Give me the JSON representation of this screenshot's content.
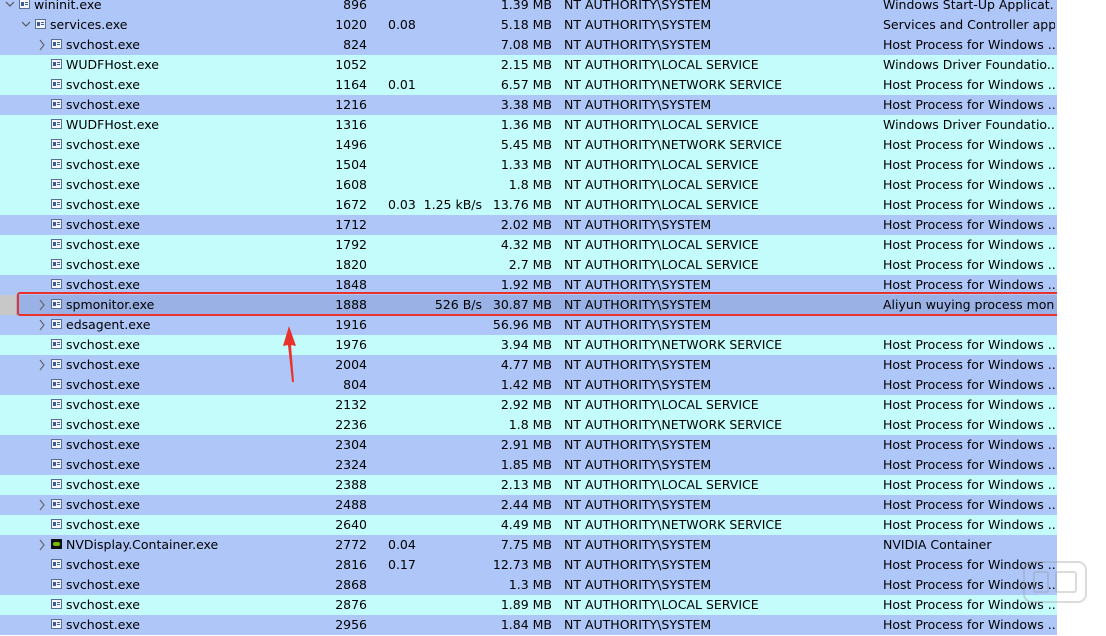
{
  "colors": {
    "row_cyan": "#c4fcfc",
    "row_blue": "#aec6f8",
    "row_selected": "#99b1e4",
    "highlight": "#e8322b"
  },
  "process_rows": [
    {
      "name": "wininit.exe",
      "pid": "896",
      "cpu": "",
      "io": "",
      "mem": "1.39 MB",
      "user": "NT AUTHORITY\\SYSTEM",
      "desc": "Windows Start-Up Applicat...",
      "indent": 0,
      "expander": "open",
      "icon": "process",
      "bg": "blue"
    },
    {
      "name": "services.exe",
      "pid": "1020",
      "cpu": "0.08",
      "io": "",
      "mem": "5.18 MB",
      "user": "NT AUTHORITY\\SYSTEM",
      "desc": "Services and Controller app",
      "indent": 1,
      "expander": "open",
      "icon": "process",
      "bg": "blue"
    },
    {
      "name": "svchost.exe",
      "pid": "824",
      "cpu": "",
      "io": "",
      "mem": "7.08 MB",
      "user": "NT AUTHORITY\\SYSTEM",
      "desc": "Host Process for Windows ...",
      "indent": 2,
      "expander": "closed",
      "icon": "process",
      "bg": "blue"
    },
    {
      "name": "WUDFHost.exe",
      "pid": "1052",
      "cpu": "",
      "io": "",
      "mem": "2.15 MB",
      "user": "NT AUTHORITY\\LOCAL SERVICE",
      "desc": "Windows Driver Foundatio...",
      "indent": 2,
      "expander": "none",
      "icon": "process",
      "bg": "cyan"
    },
    {
      "name": "svchost.exe",
      "pid": "1164",
      "cpu": "0.01",
      "io": "",
      "mem": "6.57 MB",
      "user": "NT AUTHORITY\\NETWORK SERVICE",
      "desc": "Host Process for Windows ...",
      "indent": 2,
      "expander": "none",
      "icon": "process",
      "bg": "cyan"
    },
    {
      "name": "svchost.exe",
      "pid": "1216",
      "cpu": "",
      "io": "",
      "mem": "3.38 MB",
      "user": "NT AUTHORITY\\SYSTEM",
      "desc": "Host Process for Windows ...",
      "indent": 2,
      "expander": "none",
      "icon": "process",
      "bg": "blue"
    },
    {
      "name": "WUDFHost.exe",
      "pid": "1316",
      "cpu": "",
      "io": "",
      "mem": "1.36 MB",
      "user": "NT AUTHORITY\\LOCAL SERVICE",
      "desc": "Windows Driver Foundatio...",
      "indent": 2,
      "expander": "none",
      "icon": "process",
      "bg": "cyan"
    },
    {
      "name": "svchost.exe",
      "pid": "1496",
      "cpu": "",
      "io": "",
      "mem": "5.45 MB",
      "user": "NT AUTHORITY\\NETWORK SERVICE",
      "desc": "Host Process for Windows ...",
      "indent": 2,
      "expander": "none",
      "icon": "process",
      "bg": "cyan"
    },
    {
      "name": "svchost.exe",
      "pid": "1504",
      "cpu": "",
      "io": "",
      "mem": "1.33 MB",
      "user": "NT AUTHORITY\\LOCAL SERVICE",
      "desc": "Host Process for Windows ...",
      "indent": 2,
      "expander": "none",
      "icon": "process",
      "bg": "cyan"
    },
    {
      "name": "svchost.exe",
      "pid": "1608",
      "cpu": "",
      "io": "",
      "mem": "1.8 MB",
      "user": "NT AUTHORITY\\LOCAL SERVICE",
      "desc": "Host Process for Windows ...",
      "indent": 2,
      "expander": "none",
      "icon": "process",
      "bg": "cyan"
    },
    {
      "name": "svchost.exe",
      "pid": "1672",
      "cpu": "0.03",
      "io": "1.25 kB/s",
      "mem": "13.76 MB",
      "user": "NT AUTHORITY\\LOCAL SERVICE",
      "desc": "Host Process for Windows ...",
      "indent": 2,
      "expander": "none",
      "icon": "process",
      "bg": "cyan"
    },
    {
      "name": "svchost.exe",
      "pid": "1712",
      "cpu": "",
      "io": "",
      "mem": "2.02 MB",
      "user": "NT AUTHORITY\\SYSTEM",
      "desc": "Host Process for Windows ...",
      "indent": 2,
      "expander": "none",
      "icon": "process",
      "bg": "blue"
    },
    {
      "name": "svchost.exe",
      "pid": "1792",
      "cpu": "",
      "io": "",
      "mem": "4.32 MB",
      "user": "NT AUTHORITY\\LOCAL SERVICE",
      "desc": "Host Process for Windows ...",
      "indent": 2,
      "expander": "none",
      "icon": "process",
      "bg": "cyan"
    },
    {
      "name": "svchost.exe",
      "pid": "1820",
      "cpu": "",
      "io": "",
      "mem": "2.7 MB",
      "user": "NT AUTHORITY\\LOCAL SERVICE",
      "desc": "Host Process for Windows ...",
      "indent": 2,
      "expander": "none",
      "icon": "process",
      "bg": "cyan"
    },
    {
      "name": "svchost.exe",
      "pid": "1848",
      "cpu": "",
      "io": "",
      "mem": "1.92 MB",
      "user": "NT AUTHORITY\\SYSTEM",
      "desc": "Host Process for Windows ...",
      "indent": 2,
      "expander": "none",
      "icon": "process",
      "bg": "blue"
    },
    {
      "name": "spmonitor.exe",
      "pid": "1888",
      "cpu": "",
      "io": "526 B/s",
      "mem": "30.87 MB",
      "user": "NT AUTHORITY\\SYSTEM",
      "desc": "Aliyun wuying process mon...",
      "indent": 2,
      "expander": "closed",
      "icon": "process",
      "bg": "sel"
    },
    {
      "name": "edsagent.exe",
      "pid": "1916",
      "cpu": "",
      "io": "",
      "mem": "56.96 MB",
      "user": "NT AUTHORITY\\SYSTEM",
      "desc": "",
      "indent": 2,
      "expander": "closed",
      "icon": "process",
      "bg": "blue"
    },
    {
      "name": "svchost.exe",
      "pid": "1976",
      "cpu": "",
      "io": "",
      "mem": "3.94 MB",
      "user": "NT AUTHORITY\\NETWORK SERVICE",
      "desc": "Host Process for Windows ...",
      "indent": 2,
      "expander": "none",
      "icon": "process",
      "bg": "cyan"
    },
    {
      "name": "svchost.exe",
      "pid": "2004",
      "cpu": "",
      "io": "",
      "mem": "4.77 MB",
      "user": "NT AUTHORITY\\SYSTEM",
      "desc": "Host Process for Windows ...",
      "indent": 2,
      "expander": "closed",
      "icon": "process",
      "bg": "blue"
    },
    {
      "name": "svchost.exe",
      "pid": "804",
      "cpu": "",
      "io": "",
      "mem": "1.42 MB",
      "user": "NT AUTHORITY\\SYSTEM",
      "desc": "Host Process for Windows ...",
      "indent": 2,
      "expander": "none",
      "icon": "process",
      "bg": "blue"
    },
    {
      "name": "svchost.exe",
      "pid": "2132",
      "cpu": "",
      "io": "",
      "mem": "2.92 MB",
      "user": "NT AUTHORITY\\LOCAL SERVICE",
      "desc": "Host Process for Windows ...",
      "indent": 2,
      "expander": "none",
      "icon": "process",
      "bg": "cyan"
    },
    {
      "name": "svchost.exe",
      "pid": "2236",
      "cpu": "",
      "io": "",
      "mem": "1.8 MB",
      "user": "NT AUTHORITY\\NETWORK SERVICE",
      "desc": "Host Process for Windows ...",
      "indent": 2,
      "expander": "none",
      "icon": "process",
      "bg": "cyan"
    },
    {
      "name": "svchost.exe",
      "pid": "2304",
      "cpu": "",
      "io": "",
      "mem": "2.91 MB",
      "user": "NT AUTHORITY\\SYSTEM",
      "desc": "Host Process for Windows ...",
      "indent": 2,
      "expander": "none",
      "icon": "process",
      "bg": "blue"
    },
    {
      "name": "svchost.exe",
      "pid": "2324",
      "cpu": "",
      "io": "",
      "mem": "1.85 MB",
      "user": "NT AUTHORITY\\SYSTEM",
      "desc": "Host Process for Windows ...",
      "indent": 2,
      "expander": "none",
      "icon": "process",
      "bg": "blue"
    },
    {
      "name": "svchost.exe",
      "pid": "2388",
      "cpu": "",
      "io": "",
      "mem": "2.13 MB",
      "user": "NT AUTHORITY\\LOCAL SERVICE",
      "desc": "Host Process for Windows ...",
      "indent": 2,
      "expander": "none",
      "icon": "process",
      "bg": "cyan"
    },
    {
      "name": "svchost.exe",
      "pid": "2488",
      "cpu": "",
      "io": "",
      "mem": "2.44 MB",
      "user": "NT AUTHORITY\\SYSTEM",
      "desc": "Host Process for Windows ...",
      "indent": 2,
      "expander": "closed",
      "icon": "process",
      "bg": "blue"
    },
    {
      "name": "svchost.exe",
      "pid": "2640",
      "cpu": "",
      "io": "",
      "mem": "4.49 MB",
      "user": "NT AUTHORITY\\NETWORK SERVICE",
      "desc": "Host Process for Windows ...",
      "indent": 2,
      "expander": "none",
      "icon": "process",
      "bg": "cyan"
    },
    {
      "name": "NVDisplay.Container.exe",
      "pid": "2772",
      "cpu": "0.04",
      "io": "",
      "mem": "7.75 MB",
      "user": "NT AUTHORITY\\SYSTEM",
      "desc": "NVIDIA Container",
      "indent": 2,
      "expander": "closed",
      "icon": "nvidia",
      "bg": "blue"
    },
    {
      "name": "svchost.exe",
      "pid": "2816",
      "cpu": "0.17",
      "io": "",
      "mem": "12.73 MB",
      "user": "NT AUTHORITY\\SYSTEM",
      "desc": "Host Process for Windows ...",
      "indent": 2,
      "expander": "none",
      "icon": "process",
      "bg": "blue"
    },
    {
      "name": "svchost.exe",
      "pid": "2868",
      "cpu": "",
      "io": "",
      "mem": "1.3 MB",
      "user": "NT AUTHORITY\\SYSTEM",
      "desc": "Host Process for Windows ...",
      "indent": 2,
      "expander": "none",
      "icon": "process",
      "bg": "blue"
    },
    {
      "name": "svchost.exe",
      "pid": "2876",
      "cpu": "",
      "io": "",
      "mem": "1.89 MB",
      "user": "NT AUTHORITY\\LOCAL SERVICE",
      "desc": "Host Process for Windows ...",
      "indent": 2,
      "expander": "none",
      "icon": "process",
      "bg": "cyan"
    },
    {
      "name": "svchost.exe",
      "pid": "2956",
      "cpu": "",
      "io": "",
      "mem": "1.84 MB",
      "user": "NT AUTHORITY\\SYSTEM",
      "desc": "Host Process for Windows ...",
      "indent": 2,
      "expander": "none",
      "icon": "process",
      "bg": "blue"
    }
  ]
}
